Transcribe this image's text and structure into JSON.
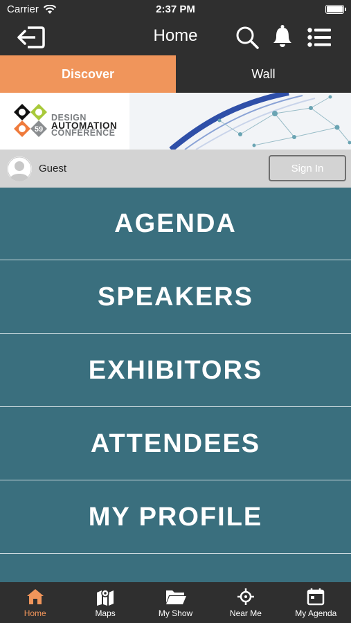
{
  "status_bar": {
    "carrier": "Carrier",
    "time": "2:37 PM"
  },
  "nav": {
    "title": "Home",
    "icons": [
      "logout-icon",
      "search-icon",
      "bell-icon",
      "list-icon"
    ]
  },
  "tabs": [
    {
      "label": "Discover",
      "active": true
    },
    {
      "label": "Wall",
      "active": false
    }
  ],
  "banner": {
    "logo_number": "59",
    "logo_lines": [
      "DESIGN",
      "AUTOMATION",
      "CONFERENCE"
    ]
  },
  "guest": {
    "name": "Guest",
    "sign_in_label": "Sign In"
  },
  "menu": [
    {
      "label": "AGENDA"
    },
    {
      "label": "SPEAKERS"
    },
    {
      "label": "EXHIBITORS"
    },
    {
      "label": "ATTENDEES"
    },
    {
      "label": "MY PROFILE"
    }
  ],
  "tab_bar": [
    {
      "label": "Home",
      "icon": "home-icon",
      "active": true
    },
    {
      "label": "Maps",
      "icon": "map-icon",
      "active": false
    },
    {
      "label": "My Show",
      "icon": "folder-icon",
      "active": false
    },
    {
      "label": "Near Me",
      "icon": "crosshair-icon",
      "active": false
    },
    {
      "label": "My Agenda",
      "icon": "calendar-icon",
      "active": false
    }
  ],
  "colors": {
    "accent": "#f0955b",
    "dark": "#2f2f2f",
    "menu_bg": "#3a6f7e",
    "guest_bar_bg": "#d3d3d3"
  }
}
